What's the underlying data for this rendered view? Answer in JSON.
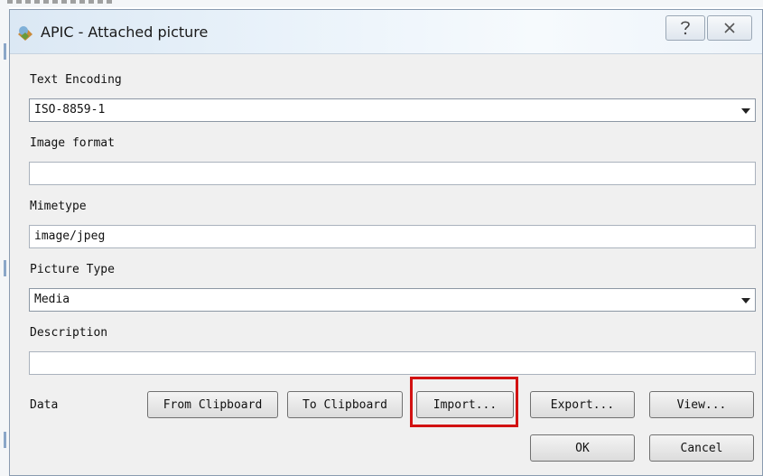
{
  "window": {
    "title": "APIC - Attached picture",
    "help_label": "?",
    "close_label": "X"
  },
  "form": {
    "text_encoding": {
      "label": "Text Encoding",
      "value": "ISO-8859-1"
    },
    "image_format": {
      "label": "Image format",
      "value": ""
    },
    "mimetype": {
      "label": "Mimetype",
      "value": "image/jpeg"
    },
    "picture_type": {
      "label": "Picture Type",
      "value": "Media"
    },
    "description": {
      "label": "Description",
      "value": ""
    },
    "data": {
      "label": "Data"
    }
  },
  "buttons": {
    "from_clipboard": "From Clipboard",
    "to_clipboard": "To Clipboard",
    "import": "Import...",
    "export": "Export...",
    "view": "View...",
    "ok": "OK",
    "cancel": "Cancel"
  },
  "colors": {
    "highlight": "#d21212",
    "dialog_bg": "#f0f0f0"
  }
}
